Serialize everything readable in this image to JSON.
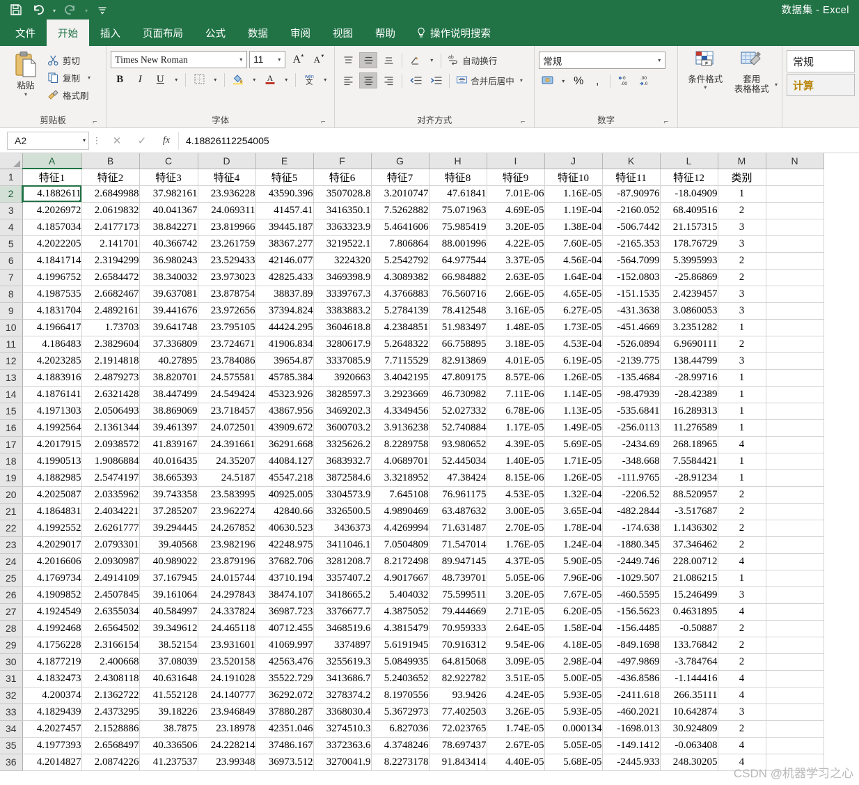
{
  "titlebar": {
    "title": "数据集  -  Excel",
    "quick_access": [
      {
        "name": "save-icon",
        "label": "保存"
      },
      {
        "name": "undo-icon",
        "label": "撤消"
      },
      {
        "name": "redo-icon",
        "label": "恢复"
      },
      {
        "name": "customize-qat-icon",
        "label": "自定义快速访问工具栏"
      }
    ]
  },
  "tabs": [
    {
      "label": "文件",
      "active": false
    },
    {
      "label": "开始",
      "active": true
    },
    {
      "label": "插入",
      "active": false
    },
    {
      "label": "页面布局",
      "active": false
    },
    {
      "label": "公式",
      "active": false
    },
    {
      "label": "数据",
      "active": false
    },
    {
      "label": "审阅",
      "active": false
    },
    {
      "label": "视图",
      "active": false
    },
    {
      "label": "帮助",
      "active": false
    }
  ],
  "tell_me": "操作说明搜索",
  "ribbon": {
    "clipboard": {
      "group_label": "剪贴板",
      "paste_label": "粘贴",
      "items": [
        {
          "label": "剪切",
          "icon": "scissors-icon"
        },
        {
          "label": "复制",
          "icon": "copy-icon"
        },
        {
          "label": "格式刷",
          "icon": "format-painter-icon"
        }
      ]
    },
    "font": {
      "group_label": "字体",
      "font_name": "Times New Roman",
      "font_size": "11",
      "bold": "B",
      "italic": "I",
      "underline": "U",
      "grow_font": "A",
      "shrink_font": "A",
      "phonetic": "wén",
      "phonetic_sub": "文"
    },
    "alignment": {
      "group_label": "对齐方式",
      "wrap_text": "自动换行",
      "merge_center": "合并后居中"
    },
    "number": {
      "group_label": "数字",
      "format": "常规",
      "percent": "%",
      "comma": ","
    },
    "styles": {
      "conditional_formatting": "条件格式",
      "format_as_table_line1": "套用",
      "format_as_table_line2": "表格格式",
      "cell_styles": [
        {
          "label": "常规",
          "kind": "normal"
        },
        {
          "label": "计算",
          "kind": "calculation"
        }
      ]
    },
    "accent_color": "#217346"
  },
  "formula_bar": {
    "name_box": "A2",
    "cancel": "✕",
    "enter": "✓",
    "fx": "fx",
    "value": "4.18826112254005"
  },
  "watermark": "CSDN @机器学习之心",
  "sheet": {
    "column_letters": [
      "A",
      "B",
      "C",
      "D",
      "E",
      "F",
      "G",
      "H",
      "I",
      "J",
      "K",
      "L",
      "M",
      "N"
    ],
    "active_column": "A",
    "active_row": 2,
    "selected_cell": "A2",
    "row_numbers": [
      1,
      2,
      3,
      4,
      5,
      6,
      7,
      8,
      9,
      10,
      11,
      12,
      13,
      14,
      15,
      16,
      17,
      18,
      19,
      20,
      21,
      22,
      23,
      24,
      25,
      26,
      27,
      28,
      29,
      30,
      31,
      32,
      33,
      34,
      35,
      36
    ],
    "headers": [
      "特征1",
      "特征2",
      "特征3",
      "特征4",
      "特征5",
      "特征6",
      "特征7",
      "特征8",
      "特征9",
      "特征10",
      "特征11",
      "特征12",
      "类别"
    ],
    "rows": [
      [
        "4.1882611",
        "2.6849988",
        "37.982161",
        "23.936228",
        "43590.396",
        "3507028.8",
        "3.2010747",
        "47.61841",
        "7.01E-06",
        "1.16E-05",
        "-87.90976",
        "-18.04909",
        "1"
      ],
      [
        "4.2026972",
        "2.0619832",
        "40.041367",
        "24.069311",
        "41457.41",
        "3416350.1",
        "7.5262882",
        "75.071963",
        "4.69E-05",
        "1.19E-04",
        "-2160.052",
        "68.409516",
        "2"
      ],
      [
        "4.1857034",
        "2.4177173",
        "38.842271",
        "23.819966",
        "39445.187",
        "3363323.9",
        "5.4641606",
        "75.985419",
        "3.20E-05",
        "1.38E-04",
        "-506.7442",
        "21.157315",
        "3"
      ],
      [
        "4.2022205",
        "2.141701",
        "40.366742",
        "23.261759",
        "38367.277",
        "3219522.1",
        "7.806864",
        "88.001996",
        "4.22E-05",
        "7.60E-05",
        "-2165.353",
        "178.76729",
        "3"
      ],
      [
        "4.1841714",
        "2.3194299",
        "36.980243",
        "23.529433",
        "42146.077",
        "3224320",
        "5.2542792",
        "64.977544",
        "3.37E-05",
        "4.56E-04",
        "-564.7099",
        "5.3995993",
        "2"
      ],
      [
        "4.1996752",
        "2.6584472",
        "38.340032",
        "23.973023",
        "42825.433",
        "3469398.9",
        "4.3089382",
        "66.984882",
        "2.63E-05",
        "1.64E-04",
        "-152.0803",
        "-25.86869",
        "2"
      ],
      [
        "4.1987535",
        "2.6682467",
        "39.637081",
        "23.878754",
        "38837.89",
        "3339767.3",
        "4.3766883",
        "76.560716",
        "2.66E-05",
        "4.65E-05",
        "-151.1535",
        "2.4239457",
        "3"
      ],
      [
        "4.1831704",
        "2.4892161",
        "39.441676",
        "23.972656",
        "37394.824",
        "3383883.2",
        "5.2784139",
        "78.412548",
        "3.16E-05",
        "6.27E-05",
        "-431.3638",
        "3.0860053",
        "3"
      ],
      [
        "4.1966417",
        "1.73703",
        "39.641748",
        "23.795105",
        "44424.295",
        "3604618.8",
        "4.2384851",
        "51.983497",
        "1.48E-05",
        "1.73E-05",
        "-451.4669",
        "3.2351282",
        "1"
      ],
      [
        "4.186483",
        "2.3829604",
        "37.336809",
        "23.724671",
        "41906.834",
        "3280617.9",
        "5.2648322",
        "66.758895",
        "3.18E-05",
        "4.53E-04",
        "-526.0894",
        "6.9690111",
        "2"
      ],
      [
        "4.2023285",
        "2.1914818",
        "40.27895",
        "23.784086",
        "39654.87",
        "3337085.9",
        "7.7115529",
        "82.913869",
        "4.01E-05",
        "6.19E-05",
        "-2139.775",
        "138.44799",
        "3"
      ],
      [
        "4.1883916",
        "2.4879273",
        "38.820701",
        "24.575581",
        "45785.384",
        "3920663",
        "3.4042195",
        "47.809175",
        "8.57E-06",
        "1.26E-05",
        "-135.4684",
        "-28.99716",
        "1"
      ],
      [
        "4.1876141",
        "2.6321428",
        "38.447499",
        "24.549424",
        "45323.926",
        "3828597.3",
        "3.2923669",
        "46.730982",
        "7.11E-06",
        "1.14E-05",
        "-98.47939",
        "-28.42389",
        "1"
      ],
      [
        "4.1971303",
        "2.0506493",
        "38.869069",
        "23.718457",
        "43867.956",
        "3469202.3",
        "4.3349456",
        "52.027332",
        "6.78E-06",
        "1.13E-05",
        "-535.6841",
        "16.289313",
        "1"
      ],
      [
        "4.1992564",
        "2.1361344",
        "39.461397",
        "24.072501",
        "43909.672",
        "3600703.2",
        "3.9136238",
        "52.740884",
        "1.17E-05",
        "1.49E-05",
        "-256.0113",
        "11.276589",
        "1"
      ],
      [
        "4.2017915",
        "2.0938572",
        "41.839167",
        "24.391661",
        "36291.668",
        "3325626.2",
        "8.2289758",
        "93.980652",
        "4.39E-05",
        "5.69E-05",
        "-2434.69",
        "268.18965",
        "4"
      ],
      [
        "4.1990513",
        "1.9086884",
        "40.016435",
        "24.35207",
        "44084.127",
        "3683932.7",
        "4.0689701",
        "52.445034",
        "1.40E-05",
        "1.71E-05",
        "-348.668",
        "7.5584421",
        "1"
      ],
      [
        "4.1882985",
        "2.5474197",
        "38.665393",
        "24.5187",
        "45547.218",
        "3872584.6",
        "3.3218952",
        "47.38424",
        "8.15E-06",
        "1.26E-05",
        "-111.9765",
        "-28.91234",
        "1"
      ],
      [
        "4.2025087",
        "2.0335962",
        "39.743358",
        "23.583995",
        "40925.005",
        "3304573.9",
        "7.645108",
        "76.961175",
        "4.53E-05",
        "1.32E-04",
        "-2206.52",
        "88.520957",
        "2"
      ],
      [
        "4.1864831",
        "2.4034221",
        "37.285207",
        "23.962274",
        "42840.66",
        "3326500.5",
        "4.9890469",
        "63.487632",
        "3.00E-05",
        "3.65E-04",
        "-482.2844",
        "-3.517687",
        "2"
      ],
      [
        "4.1992552",
        "2.6261777",
        "39.294445",
        "24.267852",
        "40630.523",
        "3436373",
        "4.4269994",
        "71.631487",
        "2.70E-05",
        "1.78E-04",
        "-174.638",
        "1.1436302",
        "2"
      ],
      [
        "4.2029017",
        "2.0793301",
        "39.40568",
        "23.982196",
        "42248.975",
        "3411046.1",
        "7.0504809",
        "71.547014",
        "1.76E-05",
        "1.24E-04",
        "-1880.345",
        "37.346462",
        "2"
      ],
      [
        "4.2016606",
        "2.0930987",
        "40.989022",
        "23.879196",
        "37682.706",
        "3281208.7",
        "8.2172498",
        "89.947145",
        "4.37E-05",
        "5.90E-05",
        "-2449.746",
        "228.00712",
        "4"
      ],
      [
        "4.1769734",
        "2.4914109",
        "37.167945",
        "24.015744",
        "43710.194",
        "3357407.2",
        "4.9017667",
        "48.739701",
        "5.05E-06",
        "7.96E-06",
        "-1029.507",
        "21.086215",
        "1"
      ],
      [
        "4.1909852",
        "2.4507845",
        "39.161064",
        "24.297843",
        "38474.107",
        "3418665.2",
        "5.404032",
        "75.599511",
        "3.20E-05",
        "7.67E-05",
        "-460.5595",
        "15.246499",
        "3"
      ],
      [
        "4.1924549",
        "2.6355034",
        "40.584997",
        "24.337824",
        "36987.723",
        "3376677.7",
        "4.3875052",
        "79.444669",
        "2.71E-05",
        "6.20E-05",
        "-156.5623",
        "0.4631895",
        "4"
      ],
      [
        "4.1992468",
        "2.6564502",
        "39.349612",
        "24.465118",
        "40712.455",
        "3468519.6",
        "4.3815479",
        "70.959333",
        "2.64E-05",
        "1.58E-04",
        "-156.4485",
        "-0.50887",
        "2"
      ],
      [
        "4.1756228",
        "2.3166154",
        "38.52154",
        "23.931601",
        "41069.997",
        "3374897",
        "5.6191945",
        "70.916312",
        "9.54E-06",
        "4.18E-05",
        "-849.1698",
        "133.76842",
        "2"
      ],
      [
        "4.1877219",
        "2.400668",
        "37.08039",
        "23.520158",
        "42563.476",
        "3255619.3",
        "5.0849935",
        "64.815068",
        "3.09E-05",
        "2.98E-04",
        "-497.9869",
        "-3.784764",
        "2"
      ],
      [
        "4.1832473",
        "2.4308118",
        "40.631648",
        "24.191028",
        "35522.729",
        "3413686.7",
        "5.2403652",
        "82.922782",
        "3.51E-05",
        "5.00E-05",
        "-436.8586",
        "-1.144416",
        "4"
      ],
      [
        "4.200374",
        "2.1362722",
        "41.552128",
        "24.140777",
        "36292.072",
        "3278374.2",
        "8.1970556",
        "93.9426",
        "4.24E-05",
        "5.93E-05",
        "-2411.618",
        "266.35111",
        "4"
      ],
      [
        "4.1829439",
        "2.4373295",
        "39.18226",
        "23.946849",
        "37880.287",
        "3368030.4",
        "5.3672973",
        "77.402503",
        "3.26E-05",
        "5.93E-05",
        "-460.2021",
        "10.642874",
        "3"
      ],
      [
        "4.2027457",
        "2.1528886",
        "38.7875",
        "23.18978",
        "42351.046",
        "3274510.3",
        "6.827036",
        "72.023765",
        "1.74E-05",
        "0.000134",
        "-1698.013",
        "30.924809",
        "2"
      ],
      [
        "4.1977393",
        "2.6568497",
        "40.336506",
        "24.228214",
        "37486.167",
        "3372363.6",
        "4.3748246",
        "78.697437",
        "2.67E-05",
        "5.05E-05",
        "-149.1412",
        "-0.063408",
        "4"
      ],
      [
        "4.2014827",
        "2.0874226",
        "41.237537",
        "23.99348",
        "36973.512",
        "3270041.9",
        "8.2273178",
        "91.843414",
        "4.40E-05",
        "5.68E-05",
        "-2445.933",
        "248.30205",
        "4"
      ]
    ]
  }
}
